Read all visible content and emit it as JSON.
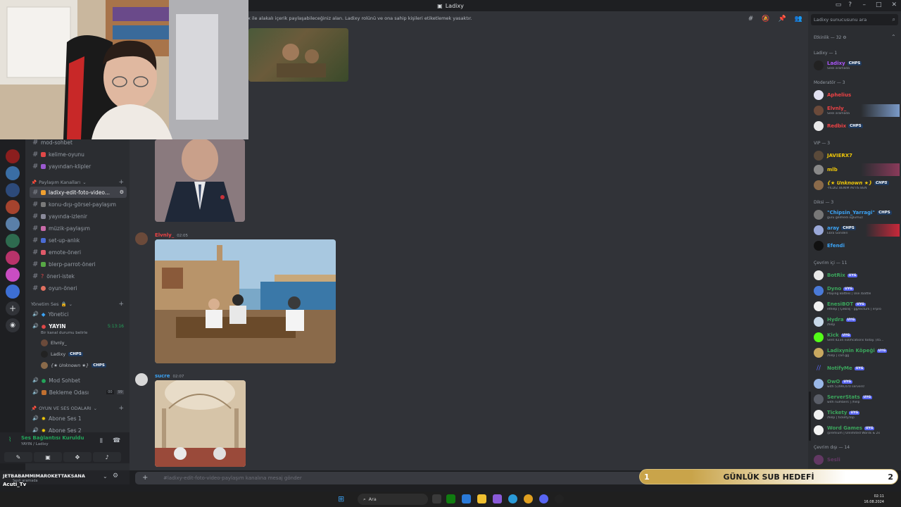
{
  "window": {
    "title": "Ladixy"
  },
  "topic": "x ile alakalı içerik paylaşabileceğiniz alan. Ladixy rolünü ve ona sahip kişileri etiketlemek yasaktır.",
  "search": {
    "placeholder": "Ladixy sunucusunu ara"
  },
  "sidebar": {
    "channels_top": [
      {
        "name": "mod-sohbet"
      },
      {
        "name": "kelime-oyunu"
      },
      {
        "name": "yayından-klipler"
      }
    ],
    "share_category": "Paylaşım Kanalları",
    "share_channels": [
      {
        "name": "ladixy-edit-foto-video..."
      },
      {
        "name": "konu-dışı-görsel-paylaşım"
      },
      {
        "name": "yayında-izlenir"
      },
      {
        "name": "müzik-paylaşım"
      },
      {
        "name": "set-up-anlık"
      },
      {
        "name": "emote-öneri"
      },
      {
        "name": "blerp-parrot-öneri"
      },
      {
        "name": "öneri-istek"
      },
      {
        "name": "oyun-öneri"
      }
    ],
    "manage_category": "Yönetim Ses",
    "voice_manager": "Yönetici",
    "voice_live": "YAYIN",
    "voice_live_timer": "5:13:16",
    "voice_live_status": "Bir kanal durumu belirle",
    "voice_users": [
      "Elvnly_",
      "Ladixy",
      "{★ Unknown ★}"
    ],
    "voice_more": [
      {
        "name": "Mod Sohbet"
      },
      {
        "name": "Bekleme Odası",
        "count": "00",
        "limit": "99"
      }
    ],
    "game_category": "OYUN VE SES ODALARI",
    "game_channels": [
      "Abone Ses 1",
      "Abone Ses 2"
    ],
    "voice_status": "Ses Bağlantısı Kuruldu",
    "voice_sub": "YAYIN / Ladixy",
    "user_name": "JETBABAMMIMAROKETTAKSANA",
    "user_sub": "Sesli aramada",
    "overlay_name": "Acuti_Tv"
  },
  "messages": [
    {
      "author": "Elvnly_",
      "time": "02:05"
    },
    {
      "author": "sucre",
      "time": "02:07"
    }
  ],
  "chat_placeholder": "#ladixy-edit-foto-video-paylaşım kanalına mesaj gönder",
  "members": {
    "activity": "Etkinlik — 32",
    "groups": [
      {
        "title": "Ladixy — 1",
        "items": [
          {
            "name": "Ladixy",
            "tag": "CHPS",
            "status": "Sesli aramada",
            "color": "#a855f7"
          }
        ]
      },
      {
        "title": "Moderatör — 3",
        "items": [
          {
            "name": "Aphelius",
            "status": "",
            "color": "#ed4245"
          },
          {
            "name": "Elvnly_",
            "status": "Sesli aramada",
            "color": "#ed4245"
          },
          {
            "name": "Redbix",
            "tag": "CHPS",
            "status": "",
            "color": "#ed4245"
          }
        ]
      },
      {
        "title": "VIP — 3",
        "items": [
          {
            "name": "JAVIERX7",
            "status": "",
            "color": "#f0c808"
          },
          {
            "name": "mlb",
            "status": "",
            "color": "#f0c808"
          },
          {
            "name": "{★ Unknown ★}",
            "tag": "CHPS",
            "status": "-YILDIZ BENIM AVTIS BEN",
            "color": "#f0c808"
          }
        ]
      },
      {
        "title": "Diksi — 3",
        "items": [
          {
            "name": "\"Chipsin_Yarragi\"",
            "tag": "CHPS",
            "status": "guru gelmedi oglumuz",
            "color": "#3ba3f5"
          },
          {
            "name": "aray",
            "tag": "CHPS",
            "status": "Ebra Gönderi",
            "color": "#3ba3f5"
          },
          {
            "name": "Efendi",
            "status": "",
            "color": "#3ba3f5"
          }
        ]
      },
      {
        "title": "Çevrim içi — 11",
        "items": [
          {
            "name": "BotRix",
            "tag": "UYG",
            "status": "",
            "color": "#3ba55c"
          },
          {
            "name": "Dyno",
            "tag": "UYG",
            "status": "Playing Battles | Use /battle",
            "color": "#3ba55c"
          },
          {
            "name": "EnesiBOT",
            "tag": "UYG",
            "status": "ethelp | Çekiliş - gg/lecturk | e!pro",
            "color": "#3ba55c"
          },
          {
            "name": "Hydra",
            "tag": "UYG",
            "status": "/help",
            "color": "#3ba55c"
          },
          {
            "name": "Kick",
            "tag": "UYG",
            "status": "Sent 4234 notifications today. (45...",
            "color": "#3ba55c"
          },
          {
            "name": "Ladixynin Köpeği",
            "tag": "UYG",
            "status": "/help | carl.gg",
            "color": "#3ba55c"
          },
          {
            "name": "NotifyMe",
            "tag": "UYG",
            "status": "",
            "color": "#3ba55c"
          },
          {
            "name": "OwO",
            "tag": "UYG",
            "status": "with 5,099,470 servers!",
            "color": "#3ba55c"
          },
          {
            "name": "ServerStats",
            "tag": "UYG",
            "status": "with numbers | /help",
            "color": "#3ba55c"
          },
          {
            "name": "Tickety",
            "tag": "UYG",
            "status": "/help | tickety.top",
            "color": "#3ba55c"
          },
          {
            "name": "Word Games",
            "tag": "UYG",
            "status": "/premium | Unlimited Words & 2x",
            "color": "#3ba55c"
          }
        ]
      }
    ],
    "offline": "Çevrim dışı — 14",
    "offline_first": "Sesli"
  },
  "subgoal": {
    "start": "1",
    "label": "GÜNLÜK SUB HEDEFİ",
    "end": "2"
  },
  "taskbar": {
    "search": "Ara",
    "time": "02:11",
    "date": "16.08.2024"
  }
}
